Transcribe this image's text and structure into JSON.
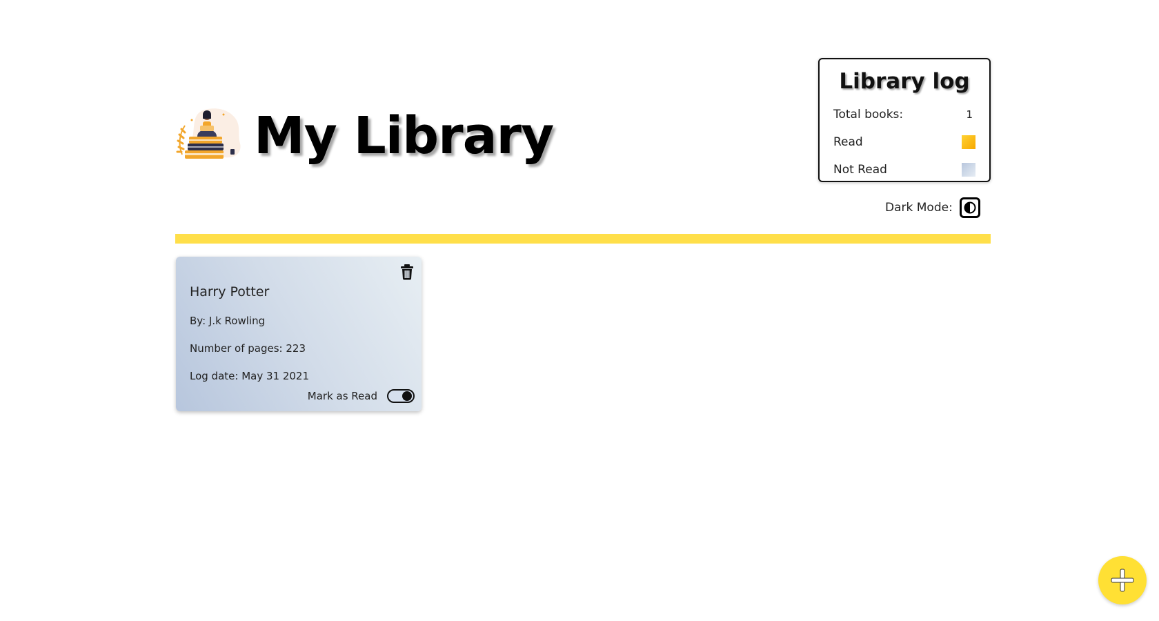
{
  "header": {
    "title": "My Library",
    "logo_icon": "reading-girl-books-icon"
  },
  "library_log": {
    "title": "Library log",
    "total_label": "Total books:",
    "total_value": "1",
    "read_label": "Read",
    "not_read_label": "Not Read",
    "read_color": "#f9b800",
    "not_read_color": "#cdd8e8"
  },
  "dark_mode": {
    "label": "Dark Mode:",
    "icon": "contrast-icon"
  },
  "books": [
    {
      "title": "Harry Potter",
      "author": "By: J.k Rowling",
      "pages": "Number of pages: 223",
      "log_date": "Log date: May 31 2021",
      "mark_label": "Mark as Read",
      "delete_icon": "trash-icon"
    }
  ],
  "add_button": {
    "icon": "plus-icon"
  },
  "colors": {
    "accent": "#ffdf4a",
    "fab": "#ffe034",
    "card_gradient_start": "#b7c6dd",
    "card_gradient_end": "#e7eef3"
  }
}
